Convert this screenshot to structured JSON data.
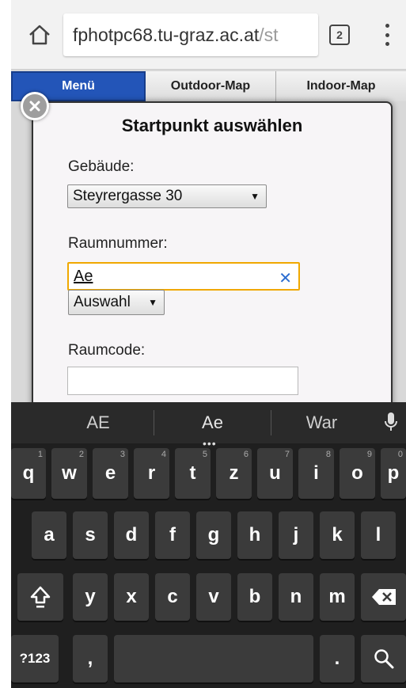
{
  "browser": {
    "url_host": "fphotpc68.tu-graz.ac.at",
    "url_path": "/st",
    "tab_count": "2"
  },
  "nav": {
    "tabs": [
      {
        "label": "Menü",
        "active": true
      },
      {
        "label": "Outdoor-Map",
        "active": false
      },
      {
        "label": "Indoor-Map",
        "active": false
      }
    ]
  },
  "dialog": {
    "title": "Startpunkt auswählen",
    "building_label": "Gebäude:",
    "building_value": "Steyrergasse 30",
    "room_label": "Raumnummer:",
    "room_value": "Ae",
    "selection_label": "Auswahl",
    "roomcode_label": "Raumcode:",
    "roomcode_value": ""
  },
  "keyboard": {
    "suggestions": [
      "AE",
      "Ae",
      "War"
    ],
    "suggestion_dots": "•••",
    "row1": [
      {
        "k": "q",
        "n": "1"
      },
      {
        "k": "w",
        "n": "2"
      },
      {
        "k": "e",
        "n": "3"
      },
      {
        "k": "r",
        "n": "4"
      },
      {
        "k": "t",
        "n": "5"
      },
      {
        "k": "z",
        "n": "6"
      },
      {
        "k": "u",
        "n": "7"
      },
      {
        "k": "i",
        "n": "8"
      },
      {
        "k": "o",
        "n": "9"
      },
      {
        "k": "p",
        "n": "0"
      }
    ],
    "row2": [
      "a",
      "s",
      "d",
      "f",
      "g",
      "h",
      "j",
      "k",
      "l"
    ],
    "row3": [
      "y",
      "x",
      "c",
      "v",
      "b",
      "n",
      "m"
    ],
    "symbols_label": "?123",
    "comma_label": ",",
    "period_label": ".",
    "icons": [
      "shift-icon",
      "backspace-icon",
      "search-icon",
      "microphone-icon",
      "home-icon",
      "close-icon"
    ]
  }
}
